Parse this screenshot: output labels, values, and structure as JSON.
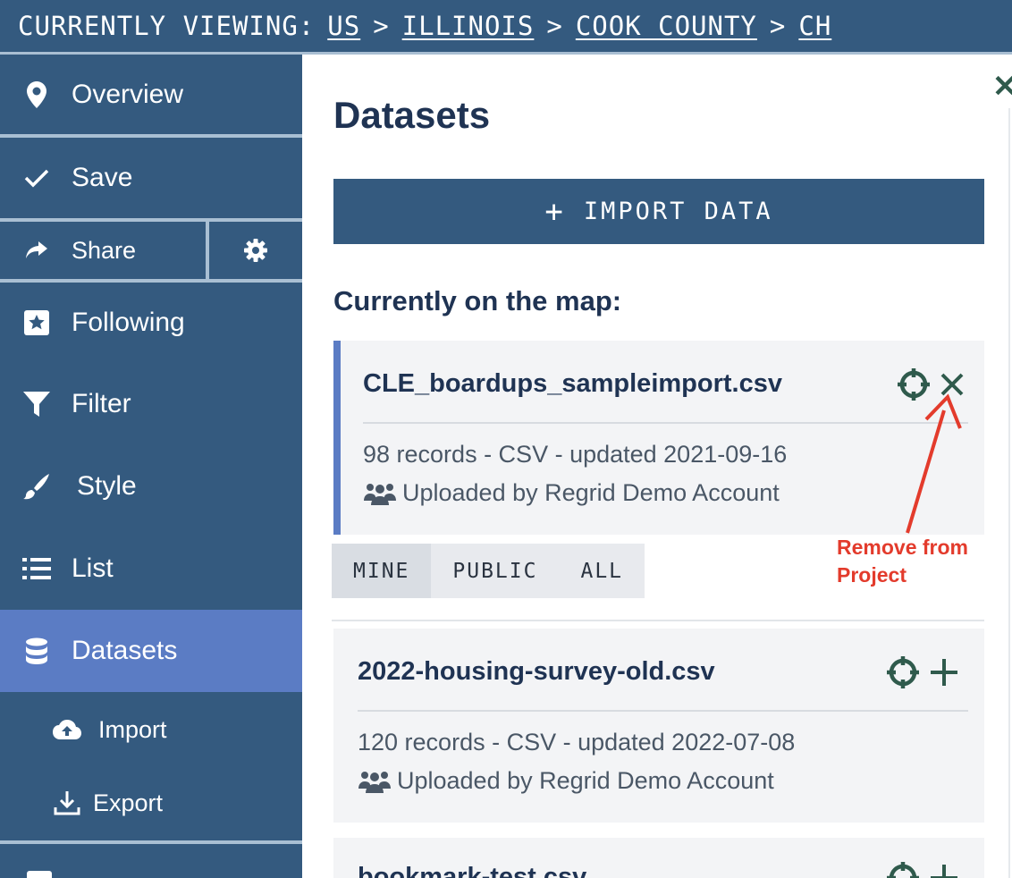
{
  "breadcrumb": {
    "prefix": "CURRENTLY VIEWING:",
    "items": [
      "US",
      "ILLINOIS",
      "COOK COUNTY",
      "CH"
    ],
    "separator": ">"
  },
  "sidebar": {
    "items": [
      {
        "label": "Overview",
        "icon": "map-pin-icon"
      },
      {
        "label": "Save",
        "icon": "check-icon"
      },
      {
        "label": "Share",
        "icon": "share-arrow-icon"
      },
      {
        "label": "Following",
        "icon": "star-box-icon"
      },
      {
        "label": "Filter",
        "icon": "funnel-icon"
      },
      {
        "label": "Style",
        "icon": "paintbrush-icon"
      },
      {
        "label": "List",
        "icon": "list-icon"
      },
      {
        "label": "Datasets",
        "icon": "database-icon"
      },
      {
        "label": "Import",
        "icon": "cloud-upload-icon"
      },
      {
        "label": "Export",
        "icon": "download-icon"
      }
    ],
    "settings_icon": "gear-icon",
    "active": "Datasets"
  },
  "main": {
    "title": "Datasets",
    "import_button": "IMPORT DATA",
    "section_title": "Currently on the map:",
    "tabs": [
      "MINE",
      "PUBLIC",
      "ALL"
    ],
    "selected_tab": "MINE",
    "datasets": [
      {
        "name": "CLE_boardups_sampleimport.csv",
        "meta": "98 records - CSV - updated 2021-09-16",
        "owner": "Uploaded by Regrid Demo Account",
        "on_map": true
      },
      {
        "name": "2022-housing-survey-old.csv",
        "meta": "120 records - CSV - updated 2022-07-08",
        "owner": "Uploaded by Regrid Demo Account",
        "on_map": false
      },
      {
        "name": "bookmark-test.csv",
        "on_map": false
      }
    ]
  },
  "annotation": {
    "line1": "Remove from",
    "line2": "Project",
    "color": "#e33b2c"
  },
  "colors": {
    "sidebar": "#345a7f",
    "active": "#5b7cc4",
    "action_icons": "#2f5a4c"
  }
}
